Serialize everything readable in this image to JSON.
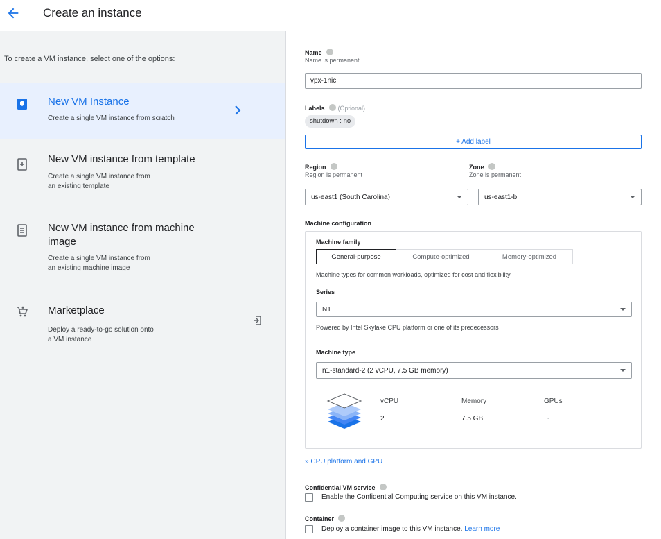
{
  "header": {
    "title": "Create an instance"
  },
  "left": {
    "intro": "To create a VM instance, select one of the options:",
    "options": [
      {
        "title": "New VM Instance",
        "desc": "Create a single VM instance from scratch"
      },
      {
        "title": "New VM instance from template",
        "desc": "Create a single VM instance from\nan existing template"
      },
      {
        "title": "New VM instance from machine\nimage",
        "desc": "Create a single VM instance from\nan existing machine image"
      },
      {
        "title": "Marketplace",
        "desc": "Deploy a ready-to-go solution onto\na VM instance"
      }
    ]
  },
  "form": {
    "name": {
      "label": "Name",
      "hint": "Name is permanent",
      "value": "vpx-1nic"
    },
    "labels": {
      "label": "Labels",
      "optional": "(Optional)",
      "chip": "shutdown : no",
      "add_label": "+ Add label"
    },
    "region": {
      "label": "Region",
      "hint": "Region is permanent",
      "value": "us-east1 (South Carolina)"
    },
    "zone": {
      "label": "Zone",
      "hint": "Zone is permanent",
      "value": "us-east1-b"
    },
    "machine_configuration": {
      "heading": "Machine configuration",
      "family_label": "Machine family",
      "family_tabs": [
        "General-purpose",
        "Compute-optimized",
        "Memory-optimized"
      ],
      "family_desc": "Machine types for common workloads, optimized for cost and flexibility",
      "series_label": "Series",
      "series_value": "N1",
      "series_desc": "Powered by Intel Skylake CPU platform or one of its predecessors",
      "type_label": "Machine type",
      "type_value": "n1-standard-2 (2 vCPU, 7.5 GB memory)",
      "specs": {
        "vcpu_label": "vCPU",
        "vcpu_value": "2",
        "memory_label": "Memory",
        "memory_value": "7.5 GB",
        "gpus_label": "GPUs",
        "gpus_value": "-"
      }
    },
    "cpu_platform_link": "CPU platform and GPU",
    "confidential": {
      "label": "Confidential VM service",
      "check": "Enable the Confidential Computing service on this VM instance."
    },
    "container": {
      "label": "Container",
      "check": "Deploy a container image to this VM instance.",
      "learn_more": "Learn more"
    }
  },
  "colors": {
    "accent": "#1a73e8",
    "selected_bg": "#e8f0fe",
    "panel_bg": "#f1f3f4"
  }
}
